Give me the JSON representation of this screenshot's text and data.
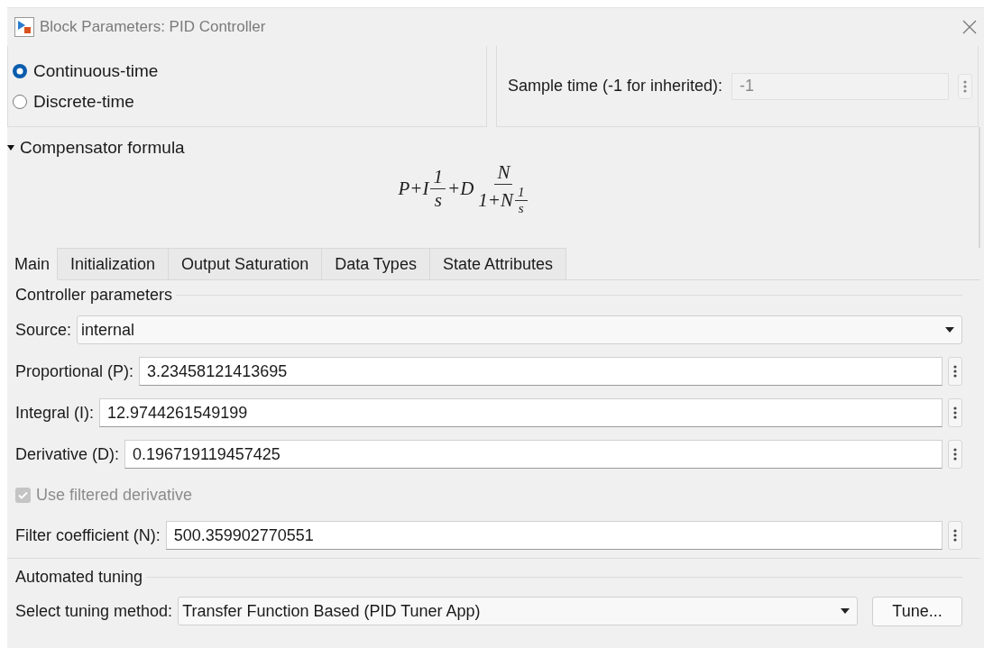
{
  "window": {
    "title": "Block Parameters: PID Controller"
  },
  "time_domain": [
    {
      "label": "Continuous-time",
      "selected": true
    },
    {
      "label": "Discrete-time",
      "selected": false
    }
  ],
  "sample_time": {
    "label": "Sample time (-1 for inherited):",
    "value": "-1",
    "disabled": true
  },
  "compensator": {
    "label": "Compensator formula",
    "expanded": true,
    "formula": [
      {
        "kind": "text",
        "text": "P+I"
      },
      {
        "kind": "frac",
        "num": [
          {
            "kind": "text",
            "text": "1"
          }
        ],
        "den": [
          {
            "kind": "text",
            "text": "s"
          }
        ]
      },
      {
        "kind": "text",
        "text": "+D"
      },
      {
        "kind": "frac",
        "num": [
          {
            "kind": "text",
            "text": "N"
          }
        ],
        "den": [
          {
            "kind": "text",
            "text": "1+N"
          },
          {
            "kind": "frac",
            "num": [
              {
                "kind": "text",
                "text": "1"
              }
            ],
            "den": [
              {
                "kind": "text",
                "text": "s"
              }
            ]
          }
        ]
      }
    ]
  },
  "tabs": [
    {
      "label": "Main",
      "selected": true
    },
    {
      "label": "Initialization",
      "selected": false
    },
    {
      "label": "Output Saturation",
      "selected": false
    },
    {
      "label": "Data Types",
      "selected": false
    },
    {
      "label": "State Attributes",
      "selected": false
    }
  ],
  "controller_parameters": {
    "title": "Controller parameters",
    "rows": [
      {
        "kind": "dropdown",
        "label": "Source:",
        "value": "internal"
      },
      {
        "kind": "field",
        "label": "Proportional (P):",
        "value": "3.23458121413695"
      },
      {
        "kind": "field",
        "label": "Integral (I):",
        "value": "12.9744261549199"
      },
      {
        "kind": "field",
        "label": "Derivative (D):",
        "value": "0.196719119457425"
      },
      {
        "kind": "checkbox",
        "label": "Use filtered derivative",
        "checked": true,
        "disabled": true
      },
      {
        "kind": "field",
        "label": "Filter coefficient (N):",
        "value": "500.359902770551"
      }
    ]
  },
  "automated_tuning": {
    "title": "Automated tuning",
    "method": {
      "label": "Select tuning method:",
      "value": "Transfer Function Based (PID Tuner App)"
    },
    "button": "Tune..."
  }
}
